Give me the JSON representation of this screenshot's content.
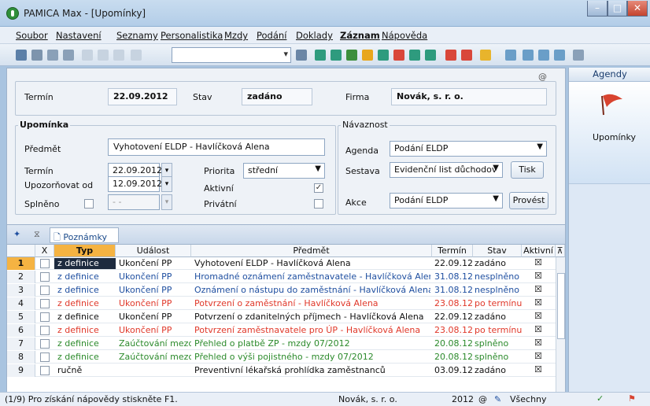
{
  "window": {
    "title": "PAMICA Max - [Upomínky]"
  },
  "menu": [
    "Soubor",
    "Nastavení",
    "Seznamy",
    "Personalistika",
    "Mzdy",
    "Podání",
    "Doklady",
    "Záznam",
    "Nápověda"
  ],
  "header": {
    "termin_label": "Termín",
    "termin_value": "22.09.2012",
    "stav_label": "Stav",
    "stav_value": "zadáno",
    "firma_label": "Firma",
    "firma_value": "Novák, s. r. o."
  },
  "upominka": {
    "section": "Upomínka",
    "predmet_label": "Předmět",
    "predmet_value": "Vyhotovení ELDP - Havlíčková Alena",
    "termin_label": "Termín",
    "termin_value": "22.09.2012",
    "upozornovat_label": "Upozorňovat od",
    "upozornovat_value": "12.09.2012",
    "splneno_label": "Splněno",
    "splneno_value": "- -",
    "priorita_label": "Priorita",
    "priorita_value": "střední",
    "aktivni_label": "Aktivní",
    "privatni_label": "Privátní"
  },
  "navaznost": {
    "section": "Návaznost",
    "agenda_label": "Agenda",
    "agenda_value": "Podání ELDP",
    "sestava_label": "Sestava",
    "sestava_value": "Evidenční list důchodov",
    "tisk_button": "Tisk",
    "akce_label": "Akce",
    "akce_value": "Podání ELDP",
    "provest_button": "Provést"
  },
  "grid": {
    "tab": "Poznámky",
    "columns": [
      "X",
      "Typ",
      "Událost",
      "Předmět",
      "Termín",
      "Stav",
      "Aktivní"
    ],
    "rows": [
      {
        "n": "1",
        "typ": "z definice",
        "udalost": "Ukončení PP",
        "predmet": "Vyhotovení ELDP - Havlíčková Alena",
        "termin": "22.09.12",
        "stav": "zadáno",
        "aktivni": "☒",
        "color": "#111111"
      },
      {
        "n": "2",
        "typ": "z definice",
        "udalost": "Ukončení PP",
        "predmet": "Hromadné oznámení zaměstnavatele - Havlíčková Alena",
        "termin": "31.08.12",
        "stav": "nesplněno",
        "aktivni": "☒",
        "color": "#1f4fa0"
      },
      {
        "n": "3",
        "typ": "z definice",
        "udalost": "Ukončení PP",
        "predmet": "Oznámení o nástupu do zaměstnání - Havlíčková Alena",
        "termin": "31.08.12",
        "stav": "nesplněno",
        "aktivni": "☒",
        "color": "#1f4fa0"
      },
      {
        "n": "4",
        "typ": "z definice",
        "udalost": "Ukončení PP",
        "predmet": "Potvrzení o zaměstnání - Havlíčková Alena",
        "termin": "23.08.12",
        "stav": "po termínu",
        "aktivni": "☒",
        "color": "#e0382a"
      },
      {
        "n": "5",
        "typ": "z definice",
        "udalost": "Ukončení PP",
        "predmet": "Potvrzení o zdanitelných příjmech - Havlíčková Alena",
        "termin": "22.09.12",
        "stav": "zadáno",
        "aktivni": "☒",
        "color": "#111111"
      },
      {
        "n": "6",
        "typ": "z definice",
        "udalost": "Ukončení PP",
        "predmet": "Potvrzení zaměstnavatele pro ÚP - Havlíčková Alena",
        "termin": "23.08.12",
        "stav": "po termínu",
        "aktivni": "☒",
        "color": "#e0382a"
      },
      {
        "n": "7",
        "typ": "z definice",
        "udalost": "Zaúčtování mezd",
        "predmet": "Přehled o platbě ZP - mzdy 07/2012",
        "termin": "20.08.12",
        "stav": "splněno",
        "aktivni": "☒",
        "color": "#2b8a2b"
      },
      {
        "n": "8",
        "typ": "z definice",
        "udalost": "Zaúčtování mezd",
        "predmet": "Přehled o výši pojistného - mzdy 07/2012",
        "termin": "20.08.12",
        "stav": "splněno",
        "aktivni": "☒",
        "color": "#2b8a2b"
      },
      {
        "n": "9",
        "typ": "ručně",
        "udalost": "",
        "predmet": "Preventivní lékařská prohlídka zaměstnanců",
        "termin": "03.09.12",
        "stav": "zadáno",
        "aktivni": "☒",
        "color": "#111111"
      }
    ]
  },
  "sidebar": {
    "title": "Agendy",
    "item": "Upomínky"
  },
  "status": {
    "hint": "(1/9) Pro získání nápovědy stiskněte F1.",
    "firm": "Novák, s. r. o.",
    "year": "2012",
    "filter": "Všechny"
  }
}
